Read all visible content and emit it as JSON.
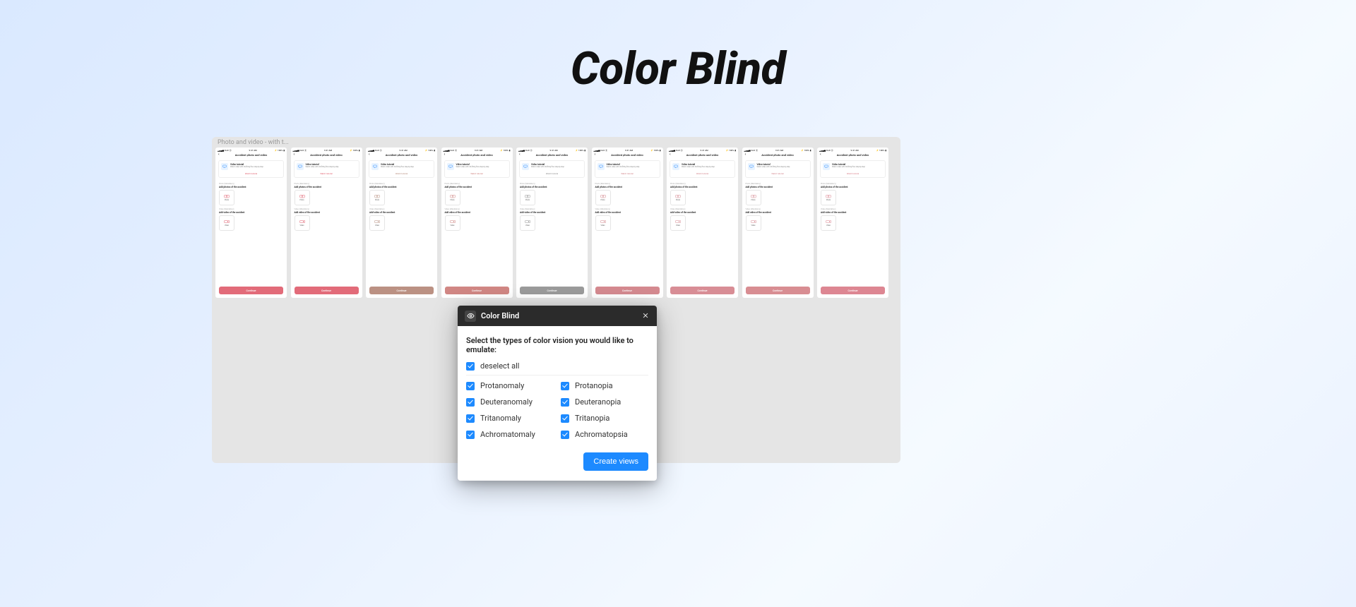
{
  "page_title": "Color Blind",
  "canvas_label": "Photo and video - with t...",
  "phone": {
    "status_time": "9:41 AM",
    "status_carrier": "DoX",
    "status_signal": "▮▮▮▮",
    "status_wifi": "✦",
    "status_batt": "100%",
    "header_title": "Accident photo and video",
    "back": "‹",
    "tutorial_title": "Video tutorial",
    "tutorial_desc": "Watch video with AS-filling flow step-by-step",
    "watch_label": "Watch tutorial",
    "photo_section_label": "Photo (Mandatory)",
    "photo_section_title": "Add photos of the accident",
    "photo_upload_label": "Photo",
    "video_section_label": "Video (Mandatory)",
    "video_section_title": "Add video of the accident",
    "video_upload_label": "Video",
    "continue_label": "Continue"
  },
  "variants": [
    {
      "accent": "#e05a6a",
      "btn": "#e26b79"
    },
    {
      "accent": "#e05a6a",
      "btn": "#e26b79"
    },
    {
      "accent": "#b58a79",
      "btn": "#bb9183"
    },
    {
      "accent": "#cd7d79",
      "btn": "#d18784"
    },
    {
      "accent": "#8c8c8c",
      "btn": "#9b9b9b"
    },
    {
      "accent": "#d07f85",
      "btn": "#d58a90"
    },
    {
      "accent": "#d3838b",
      "btn": "#d88d95"
    },
    {
      "accent": "#d3838b",
      "btn": "#d88d92"
    },
    {
      "accent": "#d97c88",
      "btn": "#dd8692"
    }
  ],
  "modal": {
    "title": "Color Blind",
    "instruction": "Select the types of color vision you would like to emulate:",
    "deselect_label": "deselect all",
    "options_left": [
      "Protanomaly",
      "Deuteranomaly",
      "Tritanomaly",
      "Achromatomaly"
    ],
    "options_right": [
      "Protanopia",
      "Deuteranopia",
      "Tritanopia",
      "Achromatopsia"
    ],
    "create_label": "Create views"
  }
}
